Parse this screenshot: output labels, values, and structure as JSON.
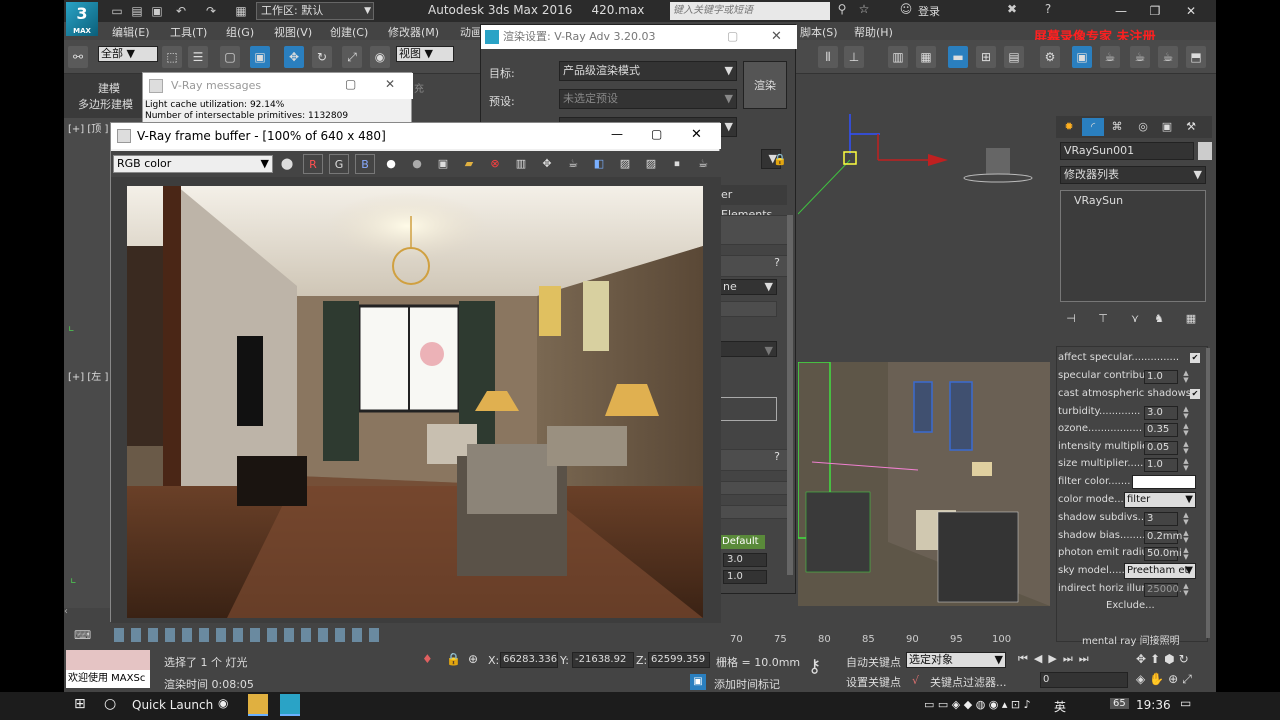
{
  "app": {
    "title": "Autodesk 3ds Max 2016",
    "file": "420.max",
    "logo": "3",
    "logo_sub": "MAX",
    "workspace": "工作区: 默认",
    "search_placeholder": "键入关键字或短语",
    "login": "登录",
    "watermark": "屏幕录像专家 未注册"
  },
  "menus": [
    "编辑(E)",
    "工具(T)",
    "组(G)",
    "视图(V)",
    "创建(C)",
    "修改器(M)",
    "动画",
    "脚本(S)",
    "帮助(H)"
  ],
  "toolbar": {
    "filter": "全部",
    "refcoord": "视图"
  },
  "ribbon": {
    "tab": "建模",
    "subtab": "多边形建模",
    "extra": "充"
  },
  "viewports": {
    "top_label": "[+] [顶 ]",
    "left_label": "[+] [左 ]"
  },
  "render_setup": {
    "title": "渲染设置: V-Ray Adv 3.20.03",
    "target_label": "目标:",
    "target_value": "产品级渲染模式",
    "preset_label": "预设:",
    "preset_value": "未选定预设",
    "render_btn": "渲染",
    "tab_elements": "er Elements",
    "q1": "?",
    "q2": "?",
    "dd1": "ne",
    "default_label": "Default",
    "v1": "3.0",
    "v2": "1.0"
  },
  "vray_messages": {
    "title": "V-Ray messages",
    "line1": "Light cache utilization: 92.14%",
    "line2": "Number of intersectable primitives: 1132809"
  },
  "vfb": {
    "title": "V-Ray frame buffer - [100% of 640 x 480]",
    "channel": "RGB color",
    "r": "R",
    "g": "G",
    "b": "B"
  },
  "command_panel": {
    "object_name": "VRaySun001",
    "modifier_list": "修改器列表",
    "stack_item": "VRaySun",
    "params": [
      {
        "label": "affect specular...............",
        "check": "✔"
      },
      {
        "label": "specular contributio",
        "value": "1.0"
      },
      {
        "label": "cast atmospheric shadows..",
        "check": "✔"
      },
      {
        "label": "turbidity.............",
        "value": "3.0"
      },
      {
        "label": "ozone.................",
        "value": "0.35"
      },
      {
        "label": "intensity multiplier..",
        "value": "0.05"
      },
      {
        "label": "size multiplier.......",
        "value": "1.0"
      },
      {
        "label": "filter color.......",
        "swatch": "#ffffff"
      },
      {
        "label": "color mode....",
        "select": "filter"
      },
      {
        "label": "shadow subdivs.......",
        "value": "3"
      },
      {
        "label": "shadow bias..........",
        "value": "0.2mm"
      },
      {
        "label": "photon emit radius.",
        "value": "50.0mi"
      },
      {
        "label": "sky model.....",
        "select": "Preetham et"
      },
      {
        "label": "indirect horiz illum..",
        "value": "25000."
      }
    ],
    "exclude": "Exclude...",
    "rollout": "mental ray 间接照明"
  },
  "timeline": {
    "ticks": [
      "70",
      "75",
      "80",
      "85",
      "90",
      "95",
      "100"
    ]
  },
  "status": {
    "welcome": "欢迎使用 MAXSc",
    "selected": "选择了 1 个 灯光",
    "render_time": "渲染时间  0:08:05",
    "x_label": "X:",
    "x": "66283.336",
    "y_label": "Y:",
    "y": "-21638.92",
    "z_label": "Z:",
    "z": "62599.359",
    "grid": "栅格 = 10.0mm",
    "add_time_tag": "添加时间标记",
    "auto_key": "自动关键点",
    "set_key": "设置关键点",
    "key_filter": "关键点过滤器...",
    "selection": "选定对象",
    "frame": "0"
  },
  "taskbar": {
    "quick_launch": "Quick Launch",
    "ime": "英",
    "badge": "65",
    "time": "19:36"
  }
}
